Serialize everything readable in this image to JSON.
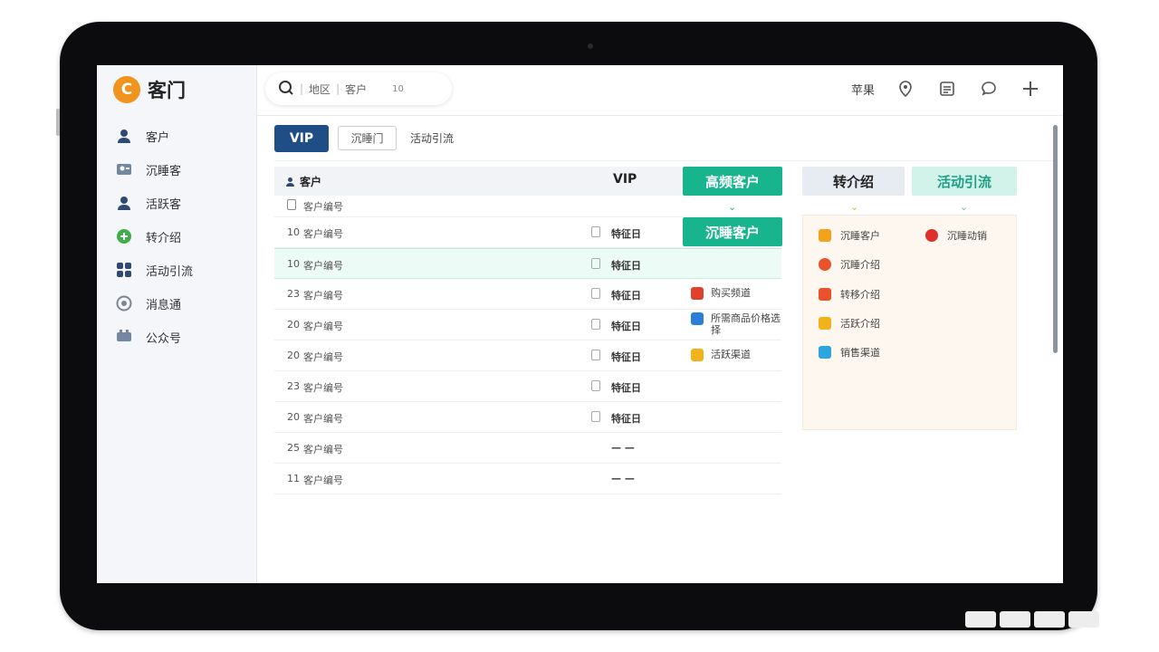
{
  "app": {
    "logo_text": "客门",
    "logo_mark": "C"
  },
  "sidebar": {
    "items": [
      {
        "label": "客户",
        "icon": "user-icon",
        "color": "#2f4a72"
      },
      {
        "label": "沉睡客",
        "icon": "users-icon",
        "color": "#5a6e8a"
      },
      {
        "label": "活跃客",
        "icon": "user-icon",
        "color": "#2f4a72"
      },
      {
        "label": "转介绍",
        "icon": "share-icon",
        "color": "#3fae4a"
      },
      {
        "label": "活动引流",
        "icon": "grid-icon",
        "color": "#2f4a72"
      },
      {
        "label": "消息通",
        "icon": "target-icon",
        "color": "#7d8794"
      },
      {
        "label": "公众号",
        "icon": "chat-icon",
        "color": "#5a6e8a"
      }
    ]
  },
  "search": {
    "icon": "search-icon",
    "field1": "地区",
    "field2": "客户",
    "count": "10"
  },
  "topbar": {
    "label": "苹果",
    "icons": [
      "location-icon",
      "document-icon",
      "message-icon",
      "plus-icon"
    ]
  },
  "tabs": {
    "primary": "VIP",
    "secondary": "沉睡门",
    "tertiary": "活动引流"
  },
  "table": {
    "header_customer": "客户",
    "header_vip": "VIP",
    "partial_row": "客户编号",
    "rows": [
      {
        "num": "10",
        "name": "客户编号",
        "date": "特征日",
        "selected": false
      },
      {
        "num": "10",
        "name": "客户编号",
        "date": "特征日",
        "selected": true
      },
      {
        "num": "23",
        "name": "客户编号",
        "date": "特征日",
        "selected": false
      },
      {
        "num": "20",
        "name": "客户编号",
        "date": "特征日",
        "selected": false
      },
      {
        "num": "20",
        "name": "客户编号",
        "date": "特征日",
        "selected": false
      },
      {
        "num": "23",
        "name": "客户编号",
        "date": "特征日",
        "selected": false
      },
      {
        "num": "20",
        "name": "客户编号",
        "date": "特征日",
        "selected": false
      },
      {
        "num": "25",
        "name": "客户编号",
        "date": "— —",
        "selected": false
      },
      {
        "num": "11",
        "name": "客户编号",
        "date": "— —",
        "selected": false
      }
    ]
  },
  "segments": {
    "high_freq": "高频客户",
    "sleeping": "沉睡客户",
    "referral": "转介绍",
    "activity": "活动引流"
  },
  "middle_list": [
    {
      "label": "购买频道",
      "color": "#e0402c"
    },
    {
      "label": "所需商品价格选择",
      "color": "#2b7fd6"
    },
    {
      "label": "活跃渠道",
      "color": "#f2b21c"
    }
  ],
  "panel": {
    "left": [
      {
        "label": "沉睡客户",
        "color": "#f2a21c"
      },
      {
        "label": "沉睡介绍",
        "color": "#e8532e"
      },
      {
        "label": "转移介绍",
        "color": "#e8532e"
      },
      {
        "label": "活跃介绍",
        "color": "#f2b21c"
      },
      {
        "label": "销售渠道",
        "color": "#2ba4e0"
      }
    ],
    "right": [
      {
        "label": "沉睡动销",
        "color": "#e0302a"
      }
    ]
  },
  "colors": {
    "accent_green": "#18b48e",
    "primary_blue": "#1f4e86"
  }
}
